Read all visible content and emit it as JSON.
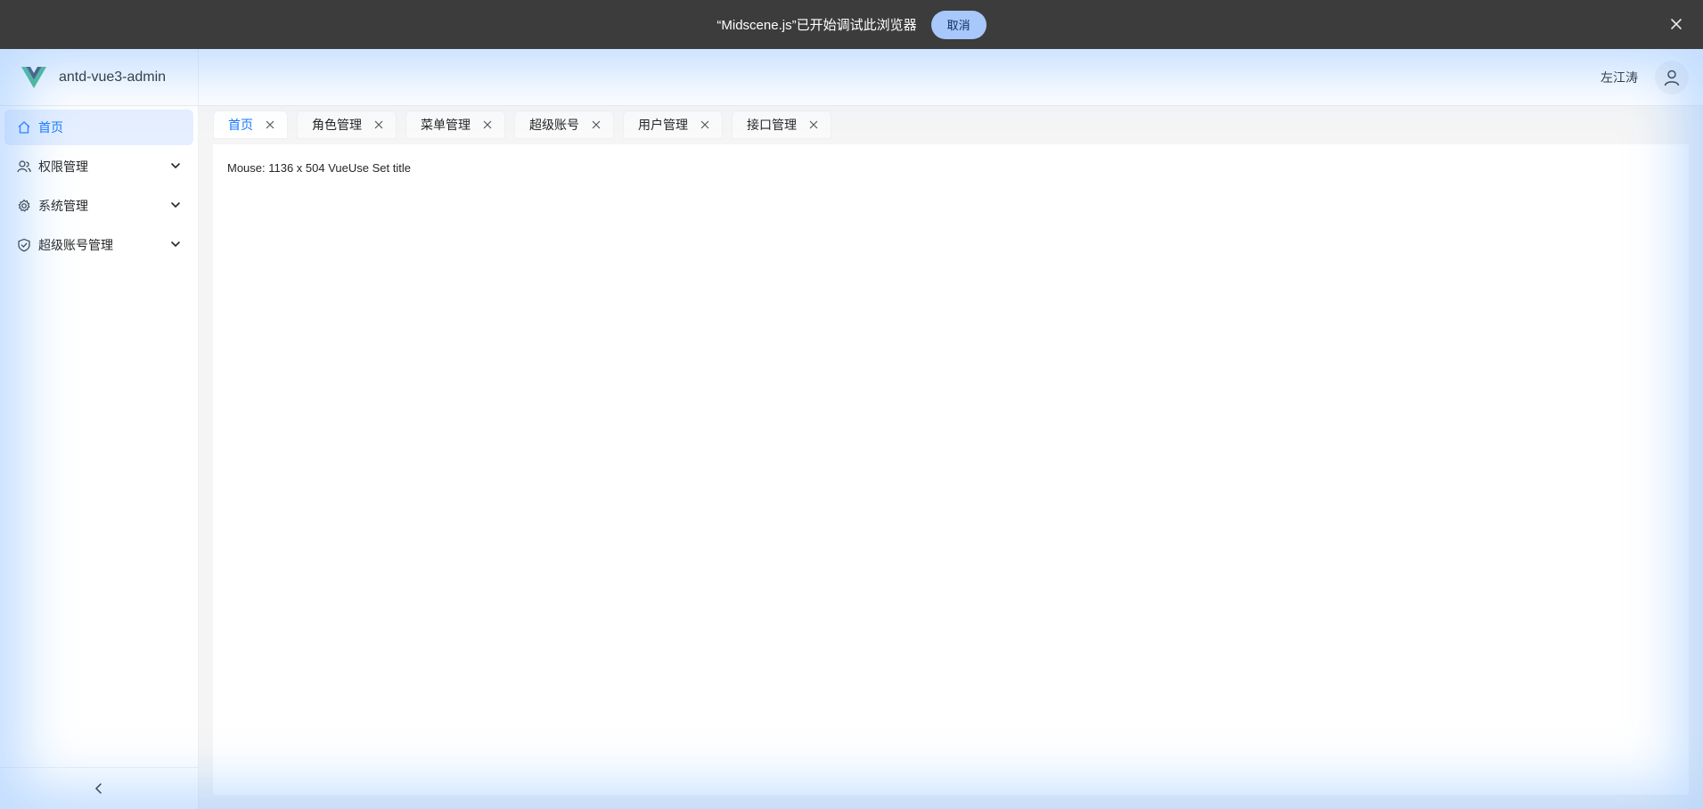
{
  "banner": {
    "text": "“Midscene.js”已开始调试此浏览器",
    "cancel_label": "取消",
    "close_icon": "close-icon"
  },
  "header": {
    "app_title": "antd-vue3-admin",
    "user_name": "左江涛",
    "logo_icon": "vue-logo-icon",
    "avatar_icon": "user-icon"
  },
  "sidebar": {
    "items": [
      {
        "label": "首页",
        "icon": "home-icon",
        "active": true
      },
      {
        "label": "权限管理",
        "icon": "users-icon",
        "expandable": true
      },
      {
        "label": "系统管理",
        "icon": "gear-icon",
        "expandable": true
      },
      {
        "label": "超级账号管理",
        "icon": "shield-icon",
        "expandable": true
      }
    ],
    "collapse_icon": "chevron-left-icon"
  },
  "tabs": [
    {
      "label": "首页",
      "active": true
    },
    {
      "label": "角色管理"
    },
    {
      "label": "菜单管理"
    },
    {
      "label": "超级账号"
    },
    {
      "label": "用户管理"
    },
    {
      "label": "接口管理"
    }
  ],
  "main": {
    "text": "Mouse: 1136 x 504 VueUse Set title"
  },
  "colors": {
    "accent": "#1677ff",
    "banner_bg": "#3c3c3c",
    "banner_button": "#a8c7fa",
    "active_menu_bg": "#e6efff"
  }
}
